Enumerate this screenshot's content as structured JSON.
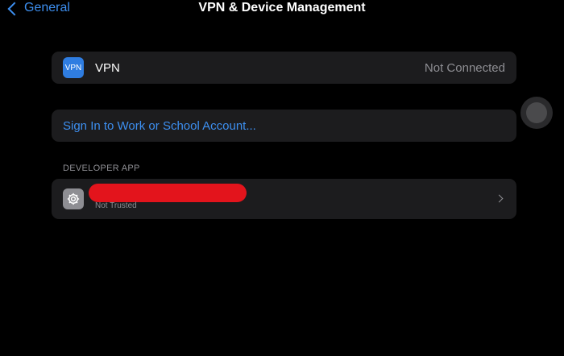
{
  "nav": {
    "back_label": "General",
    "title": "VPN & Device Management"
  },
  "vpn": {
    "icon_text": "VPN",
    "icon_color": "#2f7de1",
    "label": "VPN",
    "status": "Not Connected"
  },
  "signin": {
    "label": "Sign In to Work or School Account..."
  },
  "developer_section": {
    "header": "DEVELOPER APP",
    "app": {
      "name": "",
      "status": "Not Trusted",
      "icon": "settings-gear-icon"
    }
  },
  "colors": {
    "accent": "#3d8ff0",
    "background": "#000000",
    "card": "#1c1c1e",
    "secondary_text": "#8e8e93",
    "redaction": "#e3141c"
  }
}
